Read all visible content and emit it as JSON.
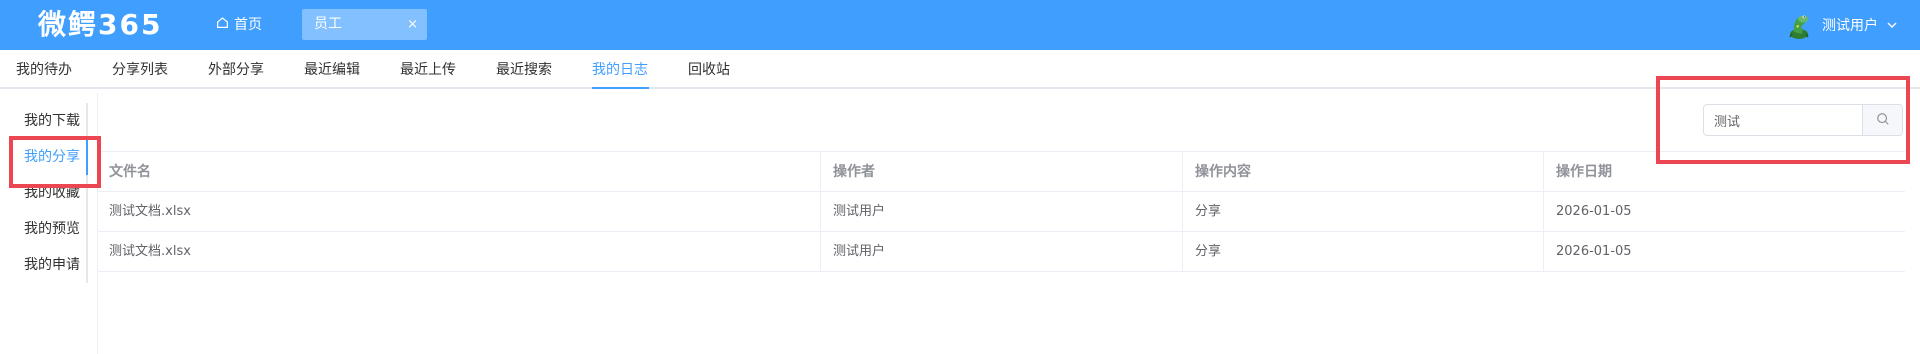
{
  "header": {
    "logo": "微鳄365",
    "home_label": "首页",
    "active_tab_label": "员工",
    "close_glyph": "×",
    "user_name": "测试用户"
  },
  "topnav": {
    "tabs": [
      {
        "label": "我的待办"
      },
      {
        "label": "分享列表"
      },
      {
        "label": "外部分享"
      },
      {
        "label": "最近编辑"
      },
      {
        "label": "最近上传"
      },
      {
        "label": "最近搜索"
      },
      {
        "label": "我的日志",
        "active": true
      },
      {
        "label": "回收站"
      }
    ]
  },
  "sidemenu": {
    "items": [
      {
        "label": "我的下载"
      },
      {
        "label": "我的分享",
        "active": true
      },
      {
        "label": "我的收藏"
      },
      {
        "label": "我的预览"
      },
      {
        "label": "我的申请"
      }
    ]
  },
  "search": {
    "value": "测试",
    "placeholder": ""
  },
  "table": {
    "columns": [
      "文件名",
      "操作者",
      "操作内容",
      "操作日期"
    ],
    "rows": [
      [
        "测试文档.xlsx",
        "测试用户",
        "分享",
        "2026-01-05"
      ],
      [
        "测试文档.xlsx",
        "测试用户",
        "分享",
        "2026-01-05"
      ]
    ]
  },
  "colors": {
    "primary": "#409eff",
    "annotation": "#ec4652"
  },
  "icons": {
    "home": "home-icon",
    "close": "close-icon",
    "avatar": "crocodile-avatar-icon",
    "chevron": "chevron-down-icon",
    "search": "search-icon"
  }
}
